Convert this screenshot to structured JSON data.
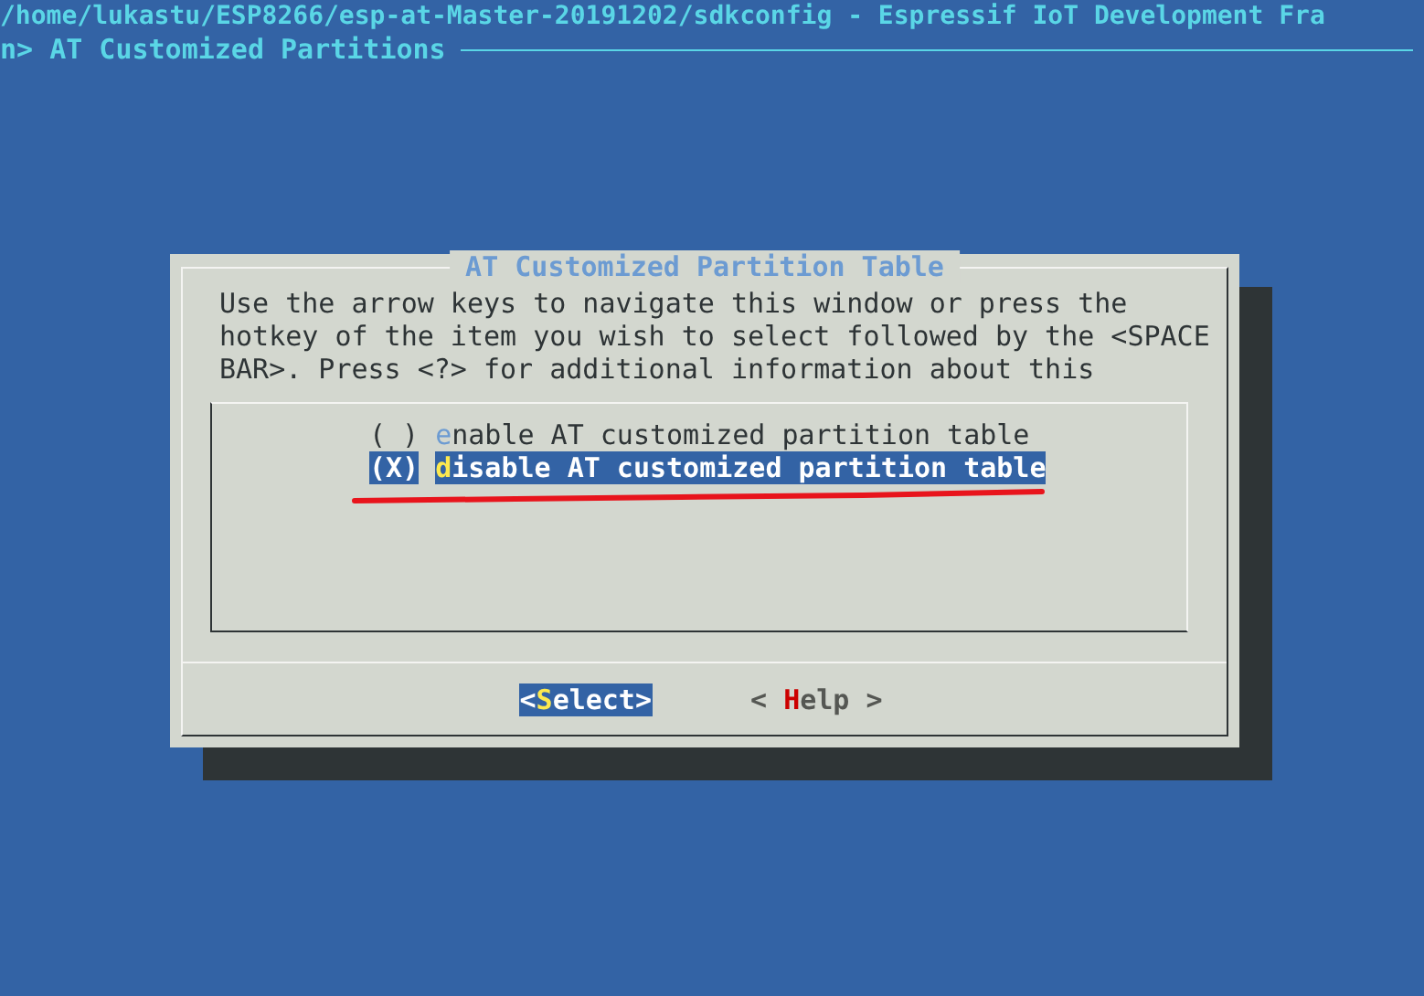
{
  "header": {
    "path_line": "/home/lukastu/ESP8266/esp-at-Master-20191202/sdkconfig - Espressif IoT Development Fra",
    "menu_title": "n> AT Customized Partitions"
  },
  "dialog": {
    "title": "AT Customized Partition Table",
    "help_lines": [
      "Use the arrow keys to navigate this window or press the",
      "hotkey of the item you wish to select followed by the <SPACE",
      "BAR>. Press <?> for additional information about this"
    ],
    "items": [
      {
        "mark": "( )",
        "label": "enable AT customized partition table",
        "checked": false,
        "selected": false
      },
      {
        "mark": "(X)",
        "label": "disable AT customized partition table",
        "checked": true,
        "selected": true
      }
    ],
    "buttons": [
      {
        "before": "<",
        "hotkey": "S",
        "after": "elect>",
        "selected": true
      },
      {
        "before": "< ",
        "hotkey": "H",
        "after": "elp >",
        "selected": false
      }
    ]
  }
}
